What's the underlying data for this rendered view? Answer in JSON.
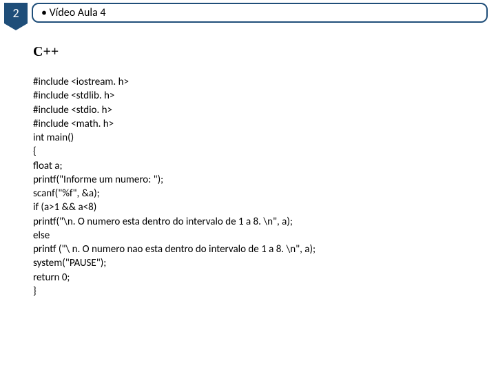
{
  "header": {
    "badge_number": "2",
    "title": "• Vídeo Aula 4"
  },
  "content": {
    "language_label": "C++",
    "code_lines": [
      "#include <iostream. h>",
      "#include <stdlib. h>",
      "#include <stdio. h>",
      "#include <math. h>",
      "int main()",
      "{",
      "float a;",
      "printf(\"Informe um numero: \");",
      "scanf(\"%f\", &a);",
      "if (a>1 && a<8)",
      "printf(\"\\n. O numero esta dentro do intervalo de 1 a 8. \\n\", a);",
      "else",
      "printf (\"\\ n. O numero nao esta dentro do intervalo de 1 a 8. \\n\", a);",
      "system(\"PAUSE\");",
      "return 0;",
      "}"
    ]
  }
}
